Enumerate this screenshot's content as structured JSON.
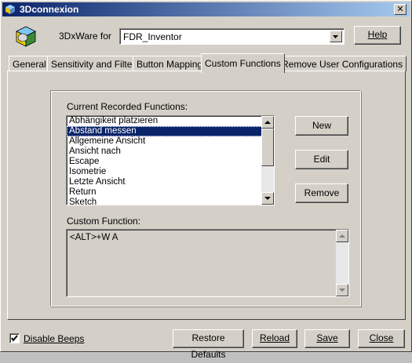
{
  "window": {
    "title": "3Dconnexion",
    "close_glyph": "✕"
  },
  "header": {
    "app_label": "3DxWare for",
    "app_value": "FDR_Inventor",
    "help_label": "Help"
  },
  "tabs": [
    {
      "label": "General"
    },
    {
      "label": "Sensitivity and Filters"
    },
    {
      "label": "Button Mapping"
    },
    {
      "label": "Custom Functions",
      "active": true
    },
    {
      "label": "Remove User Configurations"
    }
  ],
  "custom_functions": {
    "recorded_label": "Current Recorded Functions:",
    "items": [
      "Abhängikeit platzieren",
      "Abstand messen",
      "Allgemeine Ansicht",
      "Ansicht nach",
      "Escape",
      "Isometrie",
      "Letzte Ansicht",
      "Return",
      "Sketch"
    ],
    "selected_index": 1,
    "new_label": "New",
    "edit_label": "Edit",
    "remove_label": "Remove",
    "custom_label": "Custom Function:",
    "custom_value": "<ALT>+W A"
  },
  "footer": {
    "disable_beeps_label": "Disable Beeps",
    "disable_beeps_checked": true,
    "restore_label": "Restore Defaults",
    "reload_label": "Reload",
    "save_label": "Save",
    "close_label": "Close"
  },
  "colors": {
    "titlebar_start": "#0a246a",
    "titlebar_end": "#a6caf0",
    "face": "#d4d0c8",
    "selection": "#0a246a"
  }
}
